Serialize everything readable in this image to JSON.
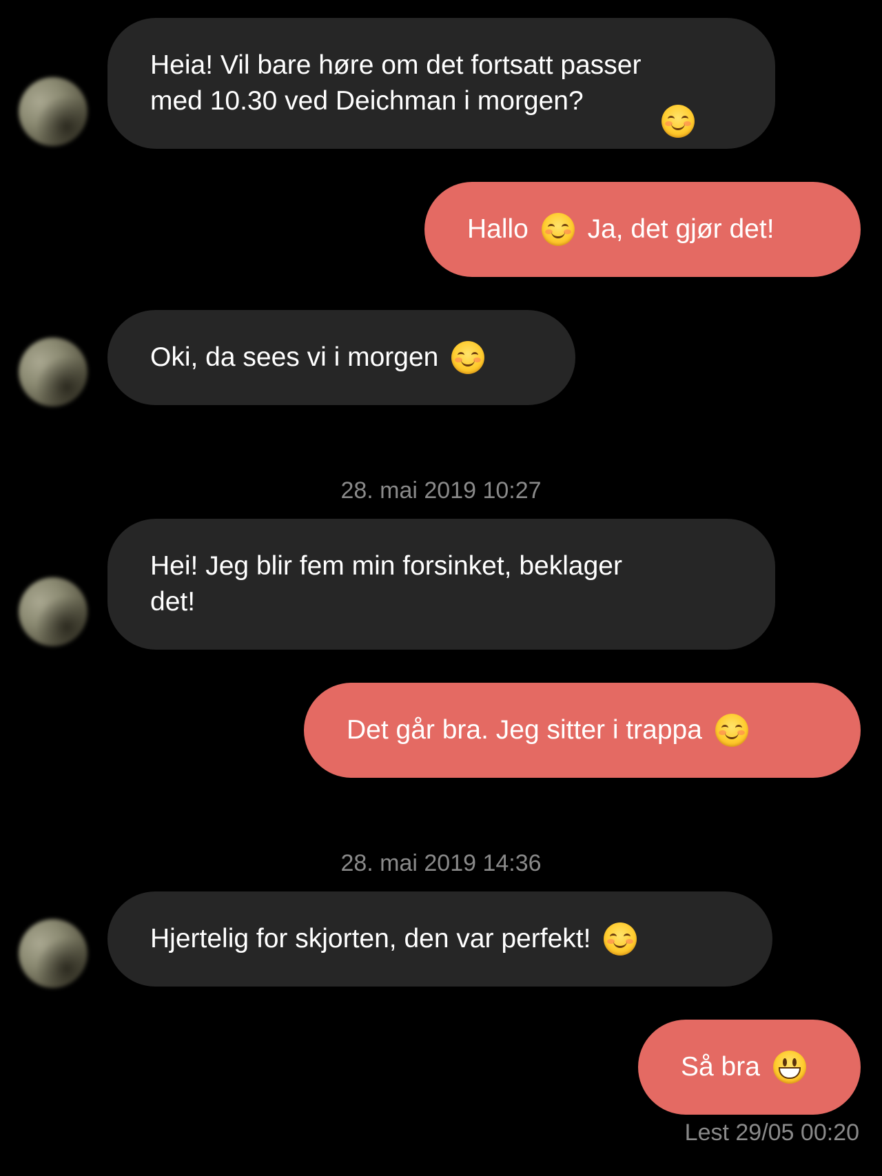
{
  "conversation": {
    "messages": [
      {
        "direction": "incoming",
        "text": "Heia! Vil bare høre om det fortsatt passer\nmed 10.30 ved Deichman i morgen? ",
        "emoji": "smiling-face-icon"
      },
      {
        "direction": "outgoing",
        "text_before": "Hallo ",
        "emoji": "smiling-face-icon",
        "text_after": " Ja, det gjør det!"
      },
      {
        "direction": "incoming",
        "text": "Oki, da sees vi i morgen ",
        "emoji": "smiling-face-icon"
      },
      {
        "direction": "incoming",
        "text": "Hei! Jeg blir fem min forsinket, beklager\ndet!"
      },
      {
        "direction": "outgoing",
        "text": "Det går bra. Jeg sitter i trappa ",
        "emoji": "smiling-face-icon"
      },
      {
        "direction": "incoming",
        "text": "Hjertelig for skjorten, den var perfekt! ",
        "emoji": "smiling-face-icon"
      },
      {
        "direction": "outgoing",
        "text": "Så bra ",
        "emoji": "grinning-face-icon"
      }
    ],
    "timestamps": [
      "28. mai 2019 10:27",
      "28. mai 2019 14:36"
    ],
    "read_receipt": "Lest 29/05 00:20"
  },
  "colors": {
    "background": "#000000",
    "incoming_bubble": "#262626",
    "outgoing_bubble": "#e46a63",
    "meta_text": "#8a8a8a"
  }
}
